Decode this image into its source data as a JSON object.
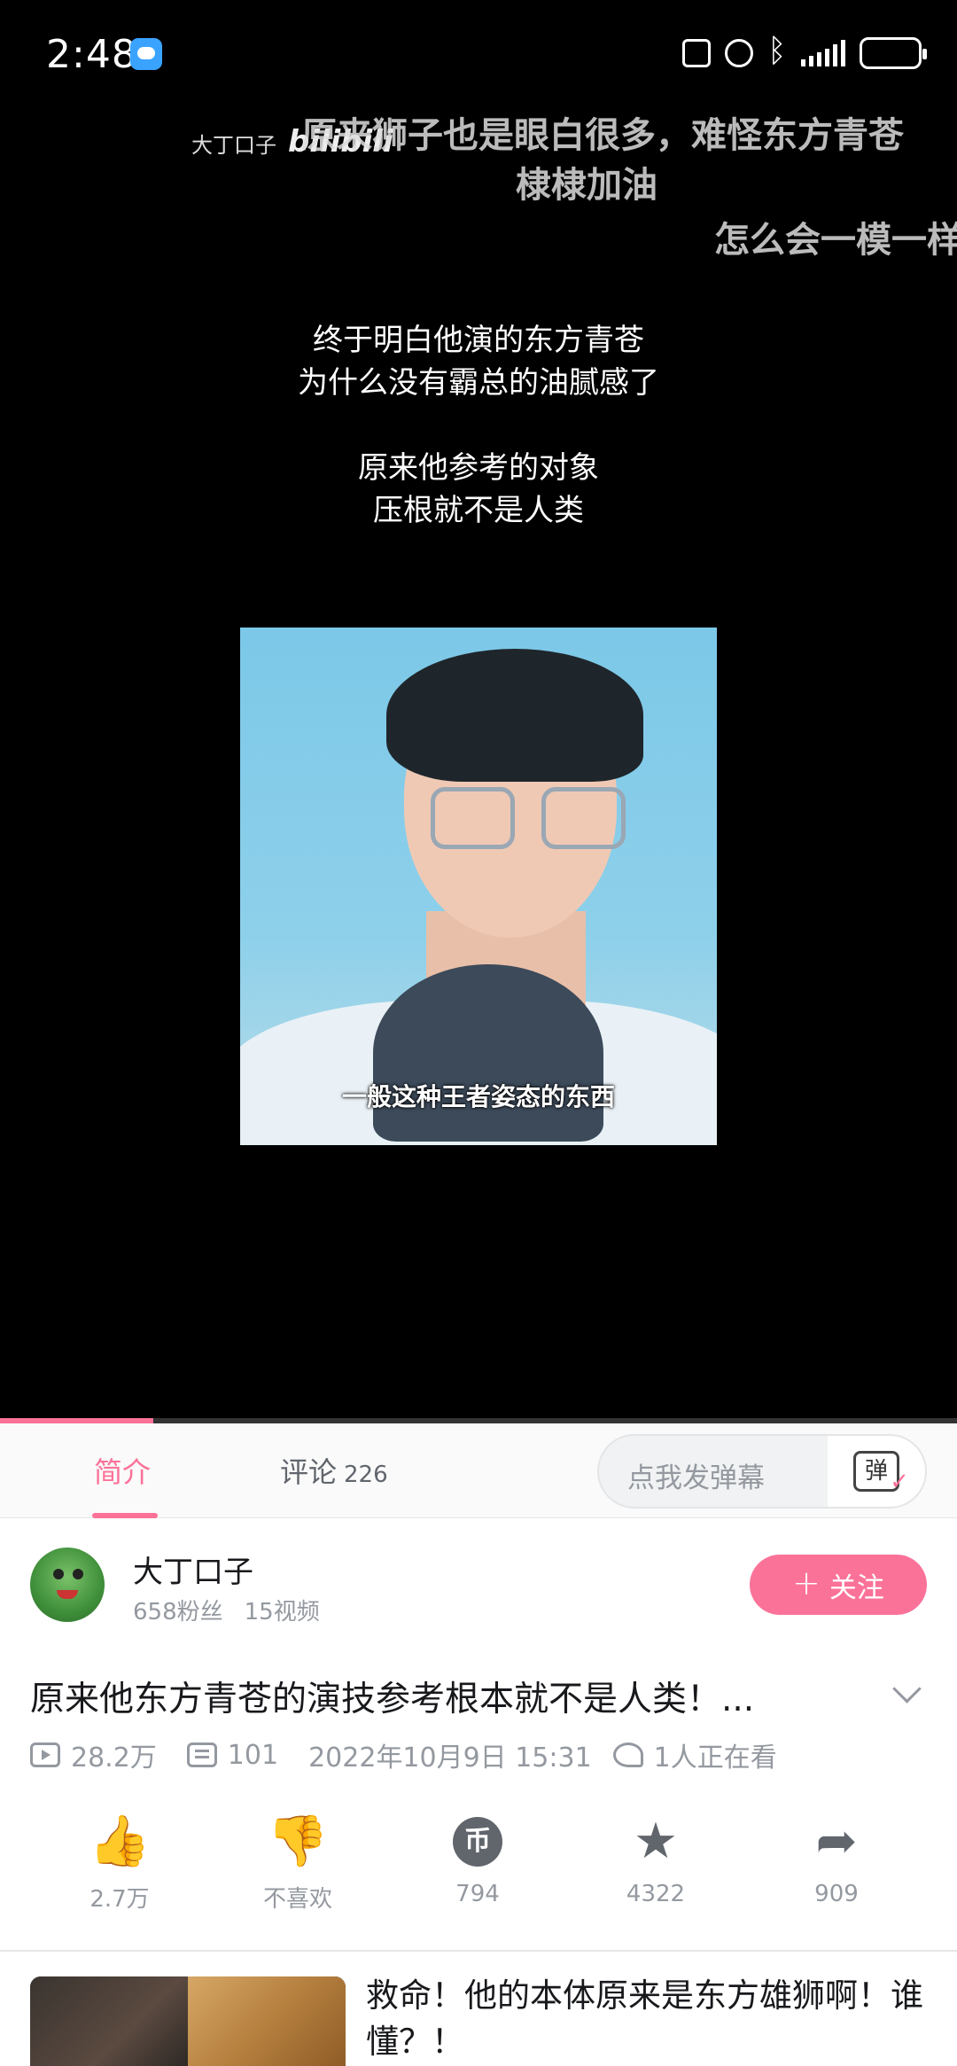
{
  "status_bar": {
    "time": "2:48"
  },
  "video": {
    "watermark_user": "大丁口子",
    "watermark_logo": "bilibili",
    "danmaku": [
      "原来狮子也是眼白很多，难怪东方青苍",
      "棣棣加油",
      "怎么会一模一样"
    ],
    "caption_lines": [
      "终于明白他演的东方青苍",
      "为什么没有霸总的油腻感了",
      "原来他参考的对象",
      "压根就不是人类"
    ],
    "subtitle": "一般这种王者姿态的东西",
    "progress": 0.16
  },
  "tabs": {
    "intro": "简介",
    "comments": "评论",
    "comments_count": "226",
    "danmaku_placeholder": "点我发弹幕",
    "danmaku_button": "弹"
  },
  "uploader": {
    "name": "大丁口子",
    "fans": "658粉丝",
    "videos": "15视频",
    "follow_label": "关注"
  },
  "video_info": {
    "title": "原来他东方青苍的演技参考根本就不是人类！...",
    "views": "28.2万",
    "danmaku_count": "101",
    "date": "2022年10月9日 15:31",
    "watching": "1人正在看"
  },
  "actions": {
    "like": "2.7万",
    "dislike": "不喜欢",
    "coin": "794",
    "favorite": "4322",
    "share": "909"
  },
  "recommended": {
    "title": "救命！他的本体原来是东方雄狮啊！谁懂？！"
  },
  "colors": {
    "accent": "#fb7299",
    "text_primary": "#18191c",
    "text_secondary": "#9499a0"
  }
}
